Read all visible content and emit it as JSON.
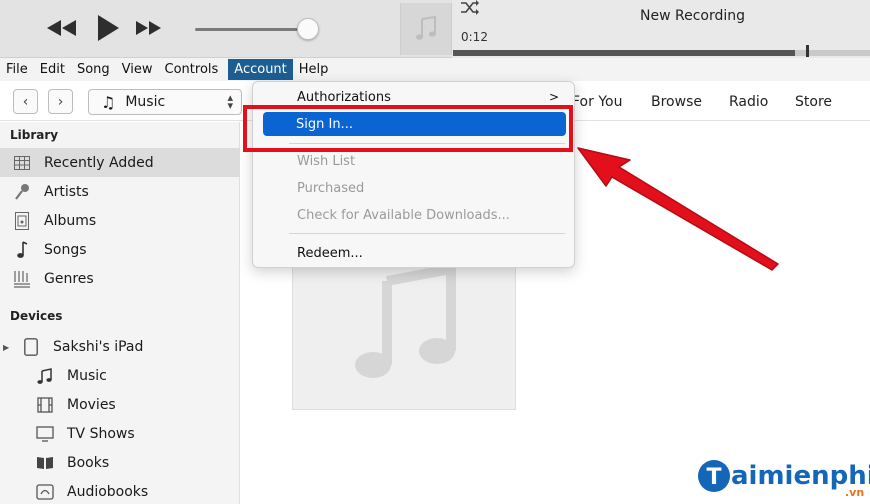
{
  "player": {
    "elapsed": "0:12",
    "track_title": "New Recording",
    "volume_level": 0.9,
    "progress_fraction": 0.82
  },
  "menubar": {
    "items": [
      "File",
      "Edit",
      "Song",
      "View",
      "Controls",
      "Account",
      "Help"
    ],
    "active": "Account"
  },
  "toolbar": {
    "back_symbol": "‹",
    "forward_symbol": "›",
    "media_kind": "Music",
    "tabs": [
      "For You",
      "Browse",
      "Radio",
      "Store"
    ]
  },
  "sidebar": {
    "library_heading": "Library",
    "library_items": [
      {
        "label": "Recently Added",
        "icon": "grid-icon"
      },
      {
        "label": "Artists",
        "icon": "microphone-icon"
      },
      {
        "label": "Albums",
        "icon": "album-icon"
      },
      {
        "label": "Songs",
        "icon": "music-note-icon"
      },
      {
        "label": "Genres",
        "icon": "genres-icon"
      }
    ],
    "devices_heading": "Devices",
    "device_name": "Sakshi's iPad",
    "device_items": [
      {
        "label": "Music",
        "icon": "music-note-icon"
      },
      {
        "label": "Movies",
        "icon": "film-icon"
      },
      {
        "label": "TV Shows",
        "icon": "tv-icon"
      },
      {
        "label": "Books",
        "icon": "book-icon"
      },
      {
        "label": "Audiobooks",
        "icon": "audiobook-icon"
      }
    ]
  },
  "account_menu": {
    "items": [
      {
        "label": "Authorizations",
        "submenu_arrow": ">",
        "disabled": false
      },
      {
        "label": "Sign In...",
        "disabled": false,
        "highlighted": true
      },
      {
        "label": "Wish List",
        "disabled": true
      },
      {
        "label": "Purchased",
        "disabled": true
      },
      {
        "label": "Check for Available Downloads...",
        "disabled": true
      },
      {
        "label": "Redeem...",
        "disabled": false
      }
    ]
  },
  "watermark": {
    "letter": "T",
    "text": "aimienphi",
    "suffix": ".vn"
  },
  "colors": {
    "menu_active": "#1c5e94",
    "highlight": "#0a64d2",
    "annotation_red": "#e3101b",
    "watermark_blue": "#1466b8"
  }
}
